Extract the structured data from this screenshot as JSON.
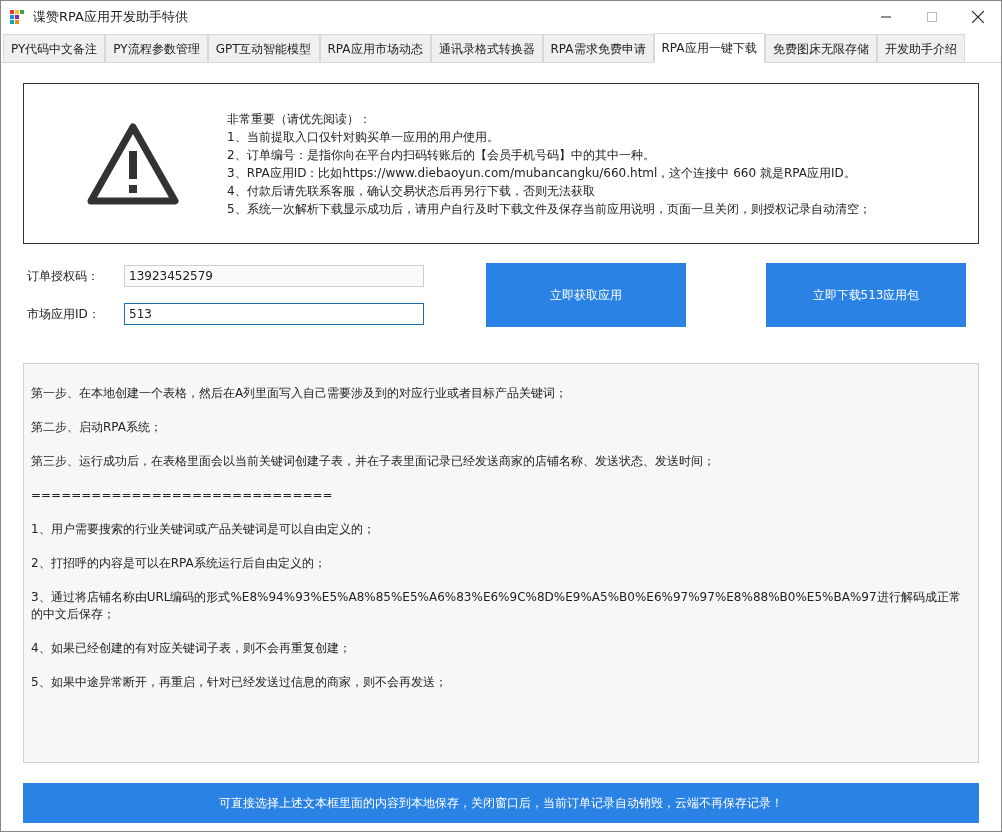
{
  "window": {
    "title": "谍赞RPA应用开发助手特供"
  },
  "tabs": [
    {
      "label": "PY代码中文备注",
      "selected": false
    },
    {
      "label": "PY流程参数管理",
      "selected": false
    },
    {
      "label": "GPT互动智能模型",
      "selected": false
    },
    {
      "label": "RPA应用市场动态",
      "selected": false
    },
    {
      "label": "通讯录格式转换器",
      "selected": false
    },
    {
      "label": "RPA需求免费申请",
      "selected": false
    },
    {
      "label": "RPA应用一键下载",
      "selected": true
    },
    {
      "label": "免费图床无限存储",
      "selected": false
    },
    {
      "label": "开发助手介绍",
      "selected": false
    }
  ],
  "notice": {
    "lines": [
      "非常重要（请优先阅读）：",
      "1、当前提取入口仅针对购买单一应用的用户使用。",
      "2、订单编号：是指你向在平台内扫码转账后的【会员手机号码】中的其中一种。",
      "3、RPA应用ID：比如https://www.diebaoyun.com/mubancangku/660.html，这个连接中 660 就是RPA应用ID。",
      "4、付款后请先联系客服，确认交易状态后再另行下载，否则无法获取",
      "5、系统一次解析下载显示成功后，请用户自行及时下载文件及保存当前应用说明，页面一旦关闭，则授权记录自动清空；"
    ]
  },
  "form": {
    "fields": [
      {
        "label": "订单授权码：",
        "value": "13923452579",
        "focused": false
      },
      {
        "label": "市场应用ID：",
        "value": "513",
        "focused": true
      }
    ],
    "buttons": [
      "立即获取应用",
      "立即下载513应用包"
    ]
  },
  "description": [
    "第一步、在本地创建一个表格，然后在A列里面写入自己需要涉及到的对应行业或者目标产品关键词；",
    "第二步、启动RPA系统；",
    "第三步、运行成功后，在表格里面会以当前关键词创建子表，并在子表里面记录已经发送商家的店铺名称、发送状态、发送时间；",
    "==============================",
    "1、用户需要搜索的行业关键词或产品关键词是可以自由定义的；",
    "2、打招呼的内容是可以在RPA系统运行后自由定义的；",
    "3、通过将店铺名称由URL编码的形式%E8%94%93%E5%A8%85%E5%A6%83%E6%9C%8D%E9%A5%B0%E6%97%97%E8%88%B0%E5%BA%97进行解码成正常的中文后保存；",
    "4、如果已经创建的有对应关键词子表，则不会再重复创建；",
    "5、如果中途异常断开，再重启，针对已经发送过信息的商家，则不会再发送；"
  ],
  "footer_button": "可直接选择上述文本框里面的内容到本地保存，关闭窗口后，当前订单记录自动销毁，云端不再保存记录！"
}
